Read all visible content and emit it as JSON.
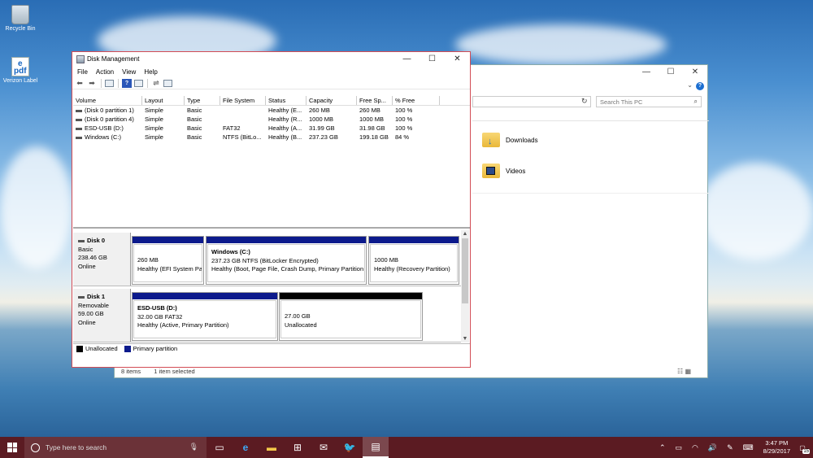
{
  "desktop": {
    "icons": [
      {
        "label": "Recycle Bin"
      },
      {
        "label": "Verizon Label",
        "glyph": "e\npdf"
      }
    ]
  },
  "explorer": {
    "controls": {
      "minimize": "—",
      "maximize": "☐",
      "close": "✕"
    },
    "search_placeholder": "Search This PC",
    "folders": [
      {
        "label": "Downloads"
      },
      {
        "label": "Videos"
      }
    ],
    "status": {
      "items": "8 items",
      "selected": "1 item selected"
    }
  },
  "disk_management": {
    "title": "Disk Management",
    "controls": {
      "minimize": "—",
      "maximize": "☐",
      "close": "✕"
    },
    "menu": [
      "File",
      "Action",
      "View",
      "Help"
    ],
    "columns": [
      "Volume",
      "Layout",
      "Type",
      "File System",
      "Status",
      "Capacity",
      "Free Sp...",
      "% Free"
    ],
    "volumes": [
      [
        "(Disk 0 partition 1)",
        "Simple",
        "Basic",
        "",
        "Healthy (E...",
        "260 MB",
        "260 MB",
        "100 %"
      ],
      [
        "(Disk 0 partition 4)",
        "Simple",
        "Basic",
        "",
        "Healthy (R...",
        "1000 MB",
        "1000 MB",
        "100 %"
      ],
      [
        "ESD-USB (D:)",
        "Simple",
        "Basic",
        "FAT32",
        "Healthy (A...",
        "31.99 GB",
        "31.98 GB",
        "100 %"
      ],
      [
        "Windows (C:)",
        "Simple",
        "Basic",
        "NTFS (BitLo...",
        "Healthy (B...",
        "237.23 GB",
        "199.18 GB",
        "84 %"
      ]
    ],
    "disks": [
      {
        "name": "Disk 0",
        "type": "Basic",
        "size": "238.46 GB",
        "state": "Online",
        "partitions": [
          {
            "title": "",
            "line1": "260 MB",
            "line2": "Healthy (EFI System Pa"
          },
          {
            "title": "Windows  (C:)",
            "line1": "237.23 GB NTFS (BitLocker Encrypted)",
            "line2": "Healthy (Boot, Page File, Crash Dump, Primary Partition"
          },
          {
            "title": "",
            "line1": "1000 MB",
            "line2": "Healthy (Recovery Partition)"
          }
        ]
      },
      {
        "name": "Disk 1",
        "type": "Removable",
        "size": "59.00 GB",
        "state": "Online",
        "partitions": [
          {
            "title": "ESD-USB  (D:)",
            "line1": "32.00 GB FAT32",
            "line2": "Healthy (Active, Primary Partition)"
          },
          {
            "title": "",
            "line1": "27.00 GB",
            "line2": "Unallocated"
          }
        ]
      }
    ],
    "legend": {
      "unallocated": "Unallocated",
      "primary": "Primary partition"
    },
    "colors": {
      "primary": "#0c1a8c",
      "unallocated": "#000000",
      "border": "#d24c55"
    }
  },
  "taskbar": {
    "search_placeholder": "Type here to search",
    "time": "3:47 PM",
    "date": "8/29/2017",
    "notification_count": "15",
    "color": "#5b1b22"
  }
}
